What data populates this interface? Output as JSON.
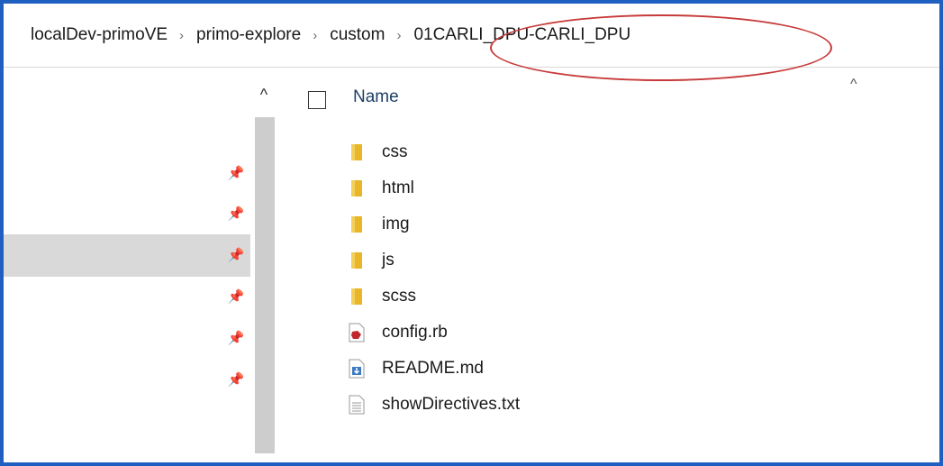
{
  "breadcrumb": {
    "items": [
      "localDev-primoVE",
      "primo-explore",
      "custom",
      "01CARLI_DPU-CARLI_DPU"
    ],
    "separator": "›"
  },
  "nav": {
    "scroll_up_glyph": "^",
    "pin_glyph": "📌"
  },
  "list": {
    "column_name": "Name",
    "sort_glyph": "^",
    "files": [
      {
        "name": "css",
        "icon": "folder-icon"
      },
      {
        "name": "html",
        "icon": "folder-icon"
      },
      {
        "name": "img",
        "icon": "folder-icon"
      },
      {
        "name": "js",
        "icon": "folder-icon"
      },
      {
        "name": "scss",
        "icon": "folder-icon"
      },
      {
        "name": "config.rb",
        "icon": "ruby-file-icon"
      },
      {
        "name": "README.md",
        "icon": "markdown-file-icon"
      },
      {
        "name": "showDirectives.txt",
        "icon": "text-file-icon"
      }
    ]
  },
  "colors": {
    "window_border": "#1f5fbf",
    "highlight_oval": "#c73a3a",
    "folder_yellow": "#e8b628",
    "selection_gray": "#d9d9d9"
  }
}
